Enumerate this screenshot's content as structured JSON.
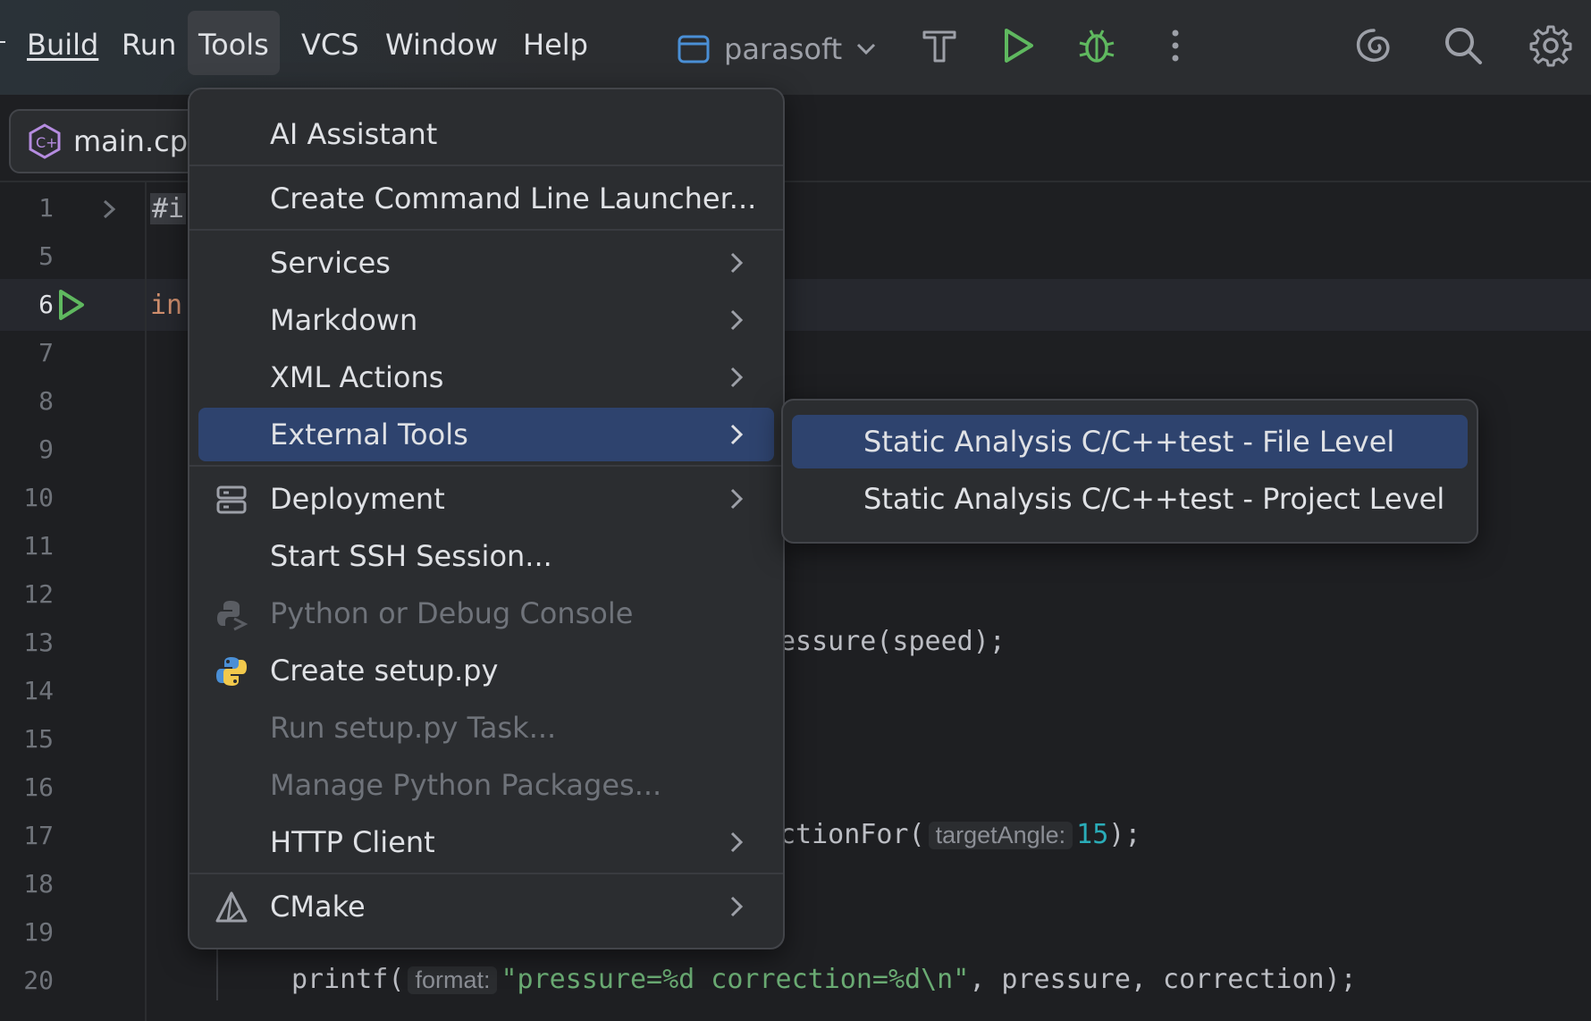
{
  "menubar": {
    "items": [
      {
        "label": "Build"
      },
      {
        "label": "Run"
      },
      {
        "label": "Tools"
      },
      {
        "label": "VCS"
      },
      {
        "label": "Window"
      },
      {
        "label": "Help"
      }
    ]
  },
  "toolbar": {
    "project_name": "parasoft"
  },
  "tabs": [
    {
      "label": "main.cpp"
    }
  ],
  "editor": {
    "line_numbers": [
      "1",
      "5",
      "6",
      "7",
      "8",
      "9",
      "10",
      "11",
      "12",
      "13",
      "14",
      "15",
      "16",
      "17",
      "18",
      "19",
      "20"
    ],
    "current_line": "6",
    "line1_fragment": "#i",
    "line6_fragment": "in",
    "line13_fragment": "essure(speed);",
    "line17_fragment_a": "ctionFor(",
    "line17_hint": "targetAngle:",
    "line17_value": "15",
    "line17_fragment_b": ");",
    "line20_func": "printf(",
    "line20_hint": "format:",
    "line20_string": "\"pressure=%d correction=%d\\n\"",
    "line20_rest": ", pressure, correction);"
  },
  "tools_menu": {
    "items": [
      {
        "label": "AI Assistant"
      },
      {
        "label": "Create Command Line Launcher..."
      },
      {
        "label": "Services"
      },
      {
        "label": "Markdown"
      },
      {
        "label": "XML Actions"
      },
      {
        "label": "External Tools"
      },
      {
        "label": "Deployment"
      },
      {
        "label": "Start SSH Session..."
      },
      {
        "label": "Python or Debug Console"
      },
      {
        "label": "Create setup.py"
      },
      {
        "label": "Run setup.py Task..."
      },
      {
        "label": "Manage Python Packages..."
      },
      {
        "label": "HTTP Client"
      },
      {
        "label": "CMake"
      }
    ]
  },
  "external_tools_submenu": {
    "items": [
      {
        "label": "Static Analysis C/C++test - File Level"
      },
      {
        "label": "Static Analysis C/C++test - Project Level"
      }
    ]
  },
  "colors": {
    "selection": "#2e436e",
    "run_green": "#5fb85f",
    "python_blue": "#4a8fd6",
    "python_yellow": "#f2c94c"
  }
}
